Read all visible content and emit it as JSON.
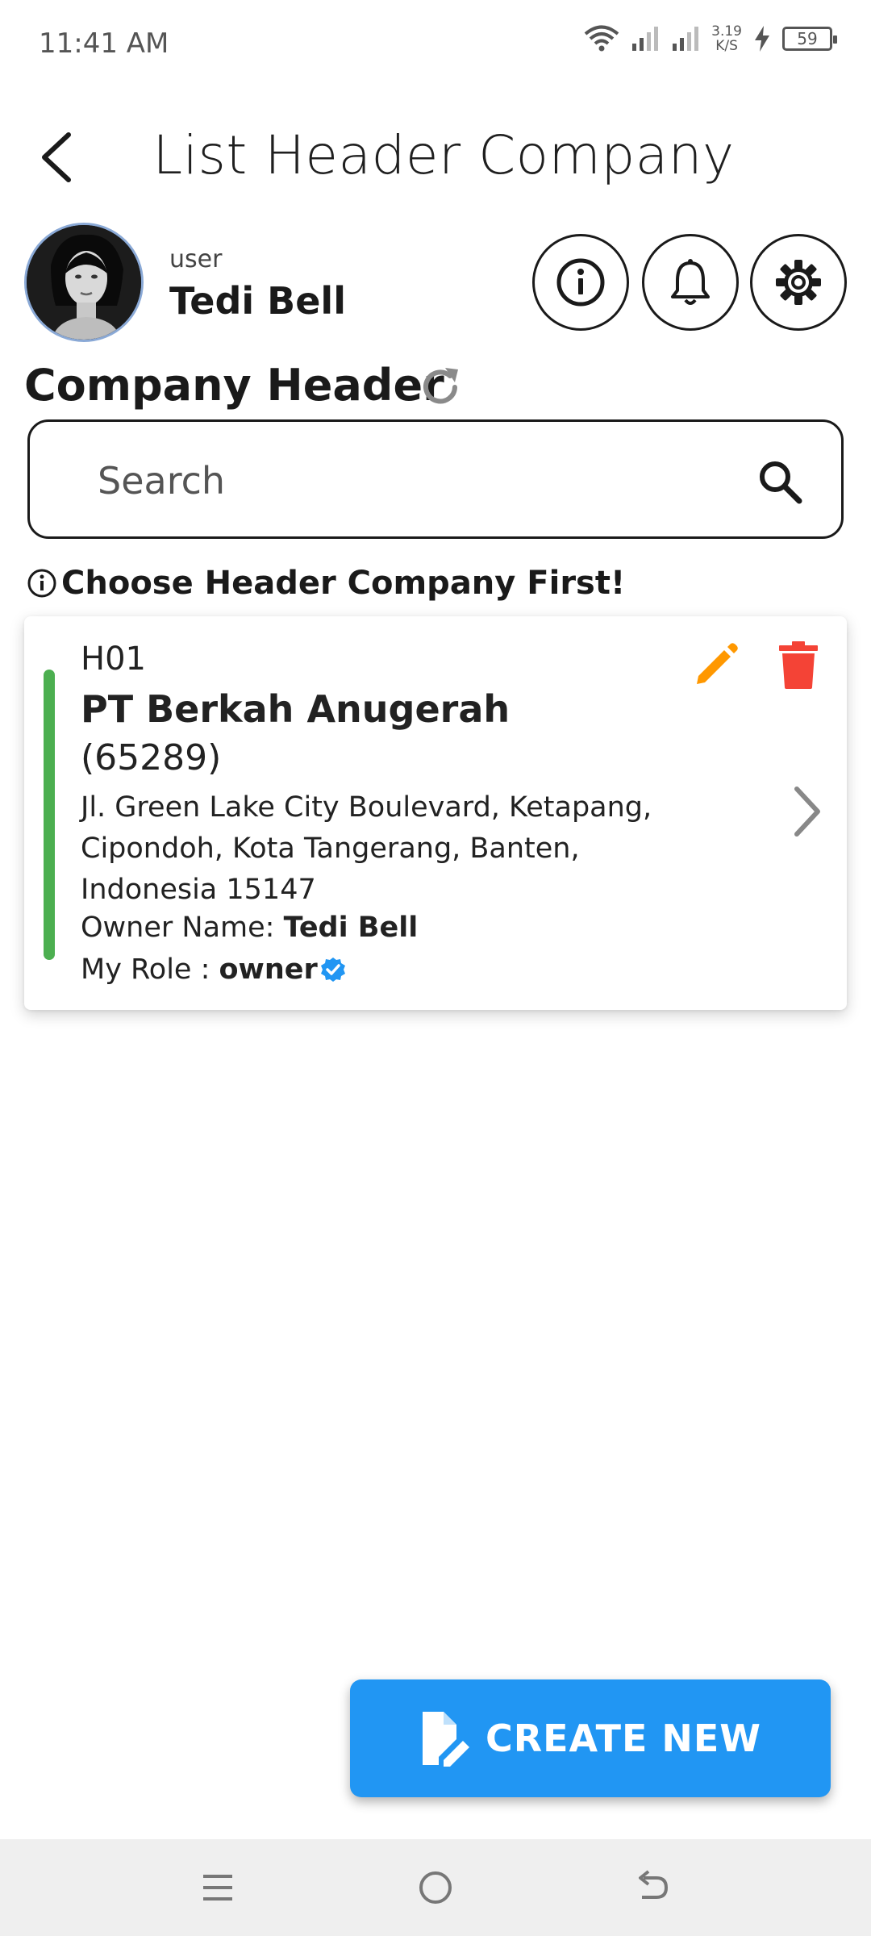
{
  "status_bar": {
    "time": "11:41 AM",
    "net_speed_value": "3.19",
    "net_speed_unit": "K/S",
    "battery": "59"
  },
  "app_bar": {
    "title": "List Header Company",
    "back_icon": "arrow-back-icon"
  },
  "user": {
    "role_label": "user",
    "name": "Tedi Bell",
    "actions": [
      {
        "icon": "info-icon"
      },
      {
        "icon": "bell-icon"
      },
      {
        "icon": "gear-icon"
      }
    ]
  },
  "section": {
    "title": "Company Header",
    "refresh_icon": "refresh-icon"
  },
  "search": {
    "placeholder": "Search",
    "value": ""
  },
  "hint": {
    "text": "Choose Header Company First!"
  },
  "companies": [
    {
      "code": "H01",
      "name": "PT Berkah Anugerah",
      "id": "(65289)",
      "address": "Jl. Green Lake City Boulevard, Ketapang, Cipondoh, Kota Tangerang, Banten, Indonesia 15147",
      "owner_label": "Owner Name: ",
      "owner_name": "Tedi Bell",
      "role_label": "My Role : ",
      "role": "owner",
      "accent_color": "#4caf50"
    }
  ],
  "fab": {
    "label": "CREATE NEW",
    "color": "#2196f3"
  },
  "colors": {
    "edit": "#ff9800",
    "delete": "#f44336",
    "verified": "#2196f3",
    "chevron": "#888888"
  }
}
